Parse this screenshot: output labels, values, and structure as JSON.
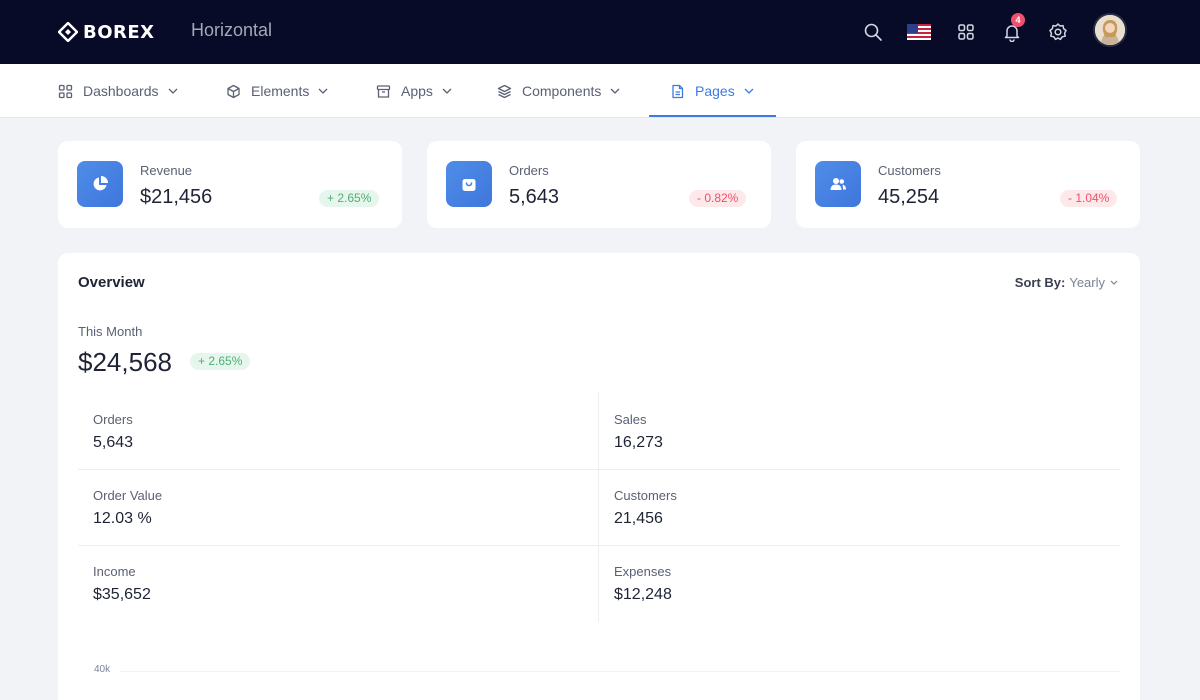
{
  "header": {
    "brand": "BOREX",
    "layout_name": "Horizontal",
    "icons": [
      "search-icon",
      "us-flag-icon",
      "apps-grid-icon",
      "bell-icon",
      "settings-gear-icon"
    ],
    "notification_count": "4",
    "avatar": "user-avatar"
  },
  "nav": {
    "items": [
      {
        "label": "Dashboards",
        "icon": "dashboard-grid-icon"
      },
      {
        "label": "Elements",
        "icon": "cube-icon"
      },
      {
        "label": "Apps",
        "icon": "archive-box-icon"
      },
      {
        "label": "Components",
        "icon": "layers-icon"
      },
      {
        "label": "Pages",
        "icon": "file-icon",
        "active": true
      }
    ]
  },
  "stats": [
    {
      "label": "Revenue",
      "value": "$21,456",
      "change": "+ 2.65%",
      "trend": "up",
      "icon": "pie-chart-icon"
    },
    {
      "label": "Orders",
      "value": "5,643",
      "change": "- 0.82%",
      "trend": "down",
      "icon": "shopping-bag-icon"
    },
    {
      "label": "Customers",
      "value": "45,254",
      "change": "- 1.04%",
      "trend": "down",
      "icon": "users-icon"
    }
  ],
  "overview": {
    "title": "Overview",
    "sort_label": "Sort By:",
    "sort_value": "Yearly",
    "this_month_label": "This Month",
    "this_month_value": "$24,568",
    "this_month_change": "+ 2.65%",
    "metrics": [
      {
        "label": "Orders",
        "value": "5,643"
      },
      {
        "label": "Sales",
        "value": "16,273"
      },
      {
        "label": "Order Value",
        "value": "12.03 %"
      },
      {
        "label": "Customers",
        "value": "21,456"
      },
      {
        "label": "Income",
        "value": "$35,652"
      },
      {
        "label": "Expenses",
        "value": "$12,248"
      }
    ],
    "chart_tick": "40k"
  },
  "colors": {
    "topbar": "#070b27",
    "accent": "#3d7be3",
    "positive": "#4caf76",
    "negative": "#f0506e"
  }
}
